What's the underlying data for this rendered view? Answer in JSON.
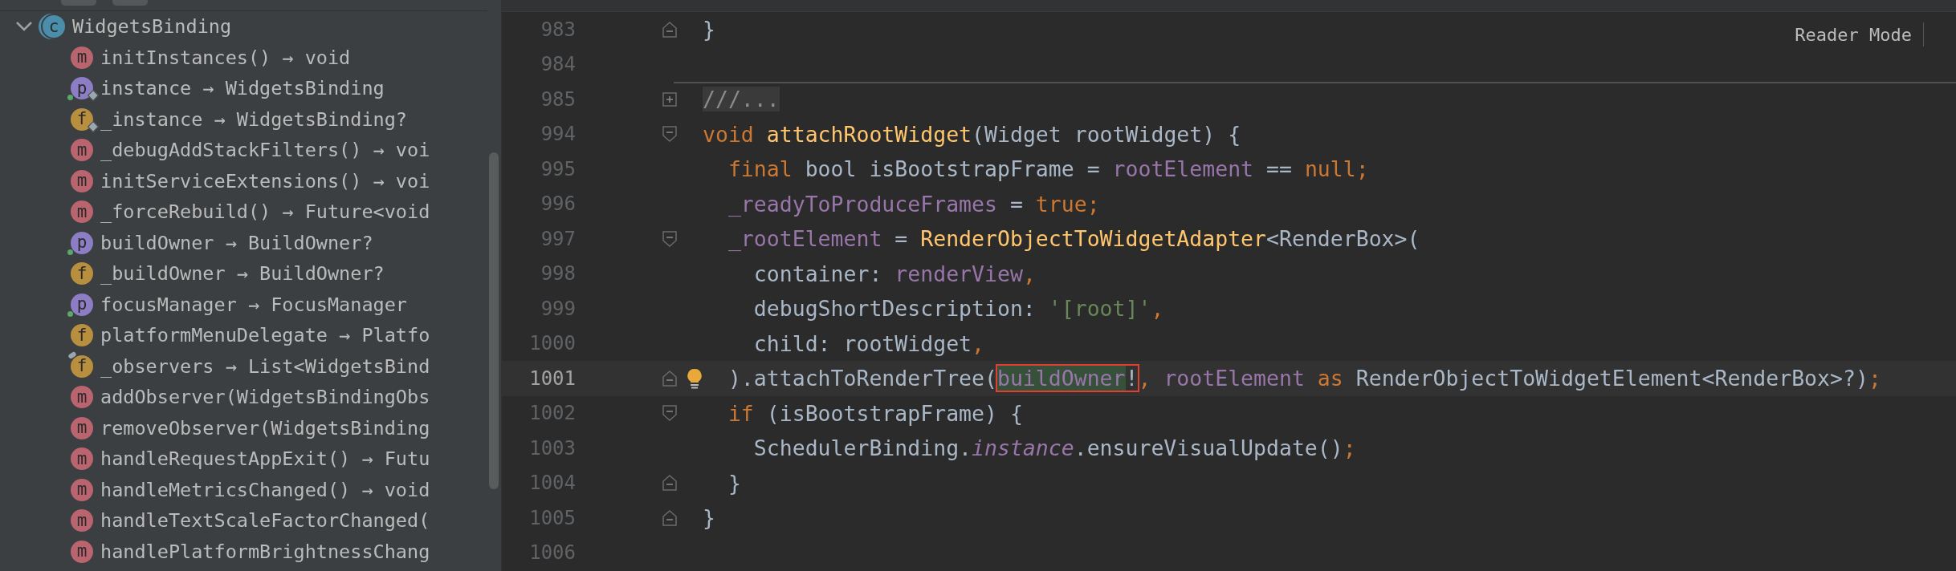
{
  "structure_panel": {
    "tree": [
      {
        "kind": "class",
        "badge": "c",
        "label": "WidgetsBinding",
        "expanded": true,
        "public_marker": false,
        "diamond_marker": false,
        "pin_marker": false,
        "children": [
          {
            "kind": "method",
            "badge": "m",
            "label": "initInstances() → void",
            "public_marker": false,
            "diamond_marker": false,
            "pin_marker": false
          },
          {
            "kind": "property",
            "badge": "p",
            "label": "instance → WidgetsBinding",
            "public_marker": true,
            "diamond_marker": true,
            "pin_marker": false
          },
          {
            "kind": "field",
            "badge": "f",
            "label": "_instance → WidgetsBinding?",
            "public_marker": false,
            "diamond_marker": true,
            "pin_marker": false
          },
          {
            "kind": "method",
            "badge": "m",
            "label": "_debugAddStackFilters() → voi",
            "public_marker": false,
            "diamond_marker": false,
            "pin_marker": false
          },
          {
            "kind": "method",
            "badge": "m",
            "label": "initServiceExtensions() → voi",
            "public_marker": false,
            "diamond_marker": false,
            "pin_marker": false
          },
          {
            "kind": "method",
            "badge": "m",
            "label": "_forceRebuild() → Future<void",
            "public_marker": false,
            "diamond_marker": false,
            "pin_marker": false
          },
          {
            "kind": "property",
            "badge": "p",
            "label": "buildOwner → BuildOwner?",
            "public_marker": true,
            "diamond_marker": false,
            "pin_marker": false
          },
          {
            "kind": "field",
            "badge": "f",
            "label": "_buildOwner → BuildOwner?",
            "public_marker": false,
            "diamond_marker": false,
            "pin_marker": false
          },
          {
            "kind": "property",
            "badge": "p",
            "label": "focusManager → FocusManager",
            "public_marker": true,
            "diamond_marker": false,
            "pin_marker": false
          },
          {
            "kind": "field",
            "badge": "f",
            "label": "platformMenuDelegate → Platfo",
            "public_marker": false,
            "diamond_marker": false,
            "pin_marker": false
          },
          {
            "kind": "field",
            "badge": "f",
            "label": "_observers → List<WidgetsBind",
            "public_marker": false,
            "diamond_marker": false,
            "pin_marker": true
          },
          {
            "kind": "method",
            "badge": "m",
            "label": "addObserver(WidgetsBindingObs",
            "public_marker": false,
            "diamond_marker": false,
            "pin_marker": false
          },
          {
            "kind": "method",
            "badge": "m",
            "label": "removeObserver(WidgetsBinding",
            "public_marker": false,
            "diamond_marker": false,
            "pin_marker": false
          },
          {
            "kind": "method",
            "badge": "m",
            "label": "handleRequestAppExit() → Futu",
            "public_marker": false,
            "diamond_marker": false,
            "pin_marker": false
          },
          {
            "kind": "method",
            "badge": "m",
            "label": "handleMetricsChanged() → void",
            "public_marker": false,
            "diamond_marker": false,
            "pin_marker": false
          },
          {
            "kind": "method",
            "badge": "m",
            "label": "handleTextScaleFactorChanged(",
            "public_marker": false,
            "diamond_marker": false,
            "pin_marker": false
          },
          {
            "kind": "method",
            "badge": "m",
            "label": "handlePlatformBrightnessChang",
            "public_marker": false,
            "diamond_marker": false,
            "pin_marker": false
          }
        ]
      }
    ]
  },
  "editor": {
    "reader_mode": {
      "label": "Reader Mode"
    },
    "lines": [
      {
        "number": "983",
        "fold": {
          "kind": "end"
        },
        "current": false,
        "tokens": [
          {
            "text": "}",
            "kind": "plain",
            "highlighted": false,
            "boxed": false
          }
        ]
      },
      {
        "number": "984",
        "current": false,
        "separator_below": true
      },
      {
        "number": "985",
        "fold": {
          "kind": "collapsed"
        },
        "current": false,
        "tokens": [
          {
            "text": "///...",
            "kind": "folded",
            "highlighted": false,
            "boxed": false
          }
        ]
      },
      {
        "number": "994",
        "fold": {
          "kind": "start"
        },
        "current": false,
        "tokens": [
          {
            "text": "void",
            "kind": "keyword",
            "highlighted": false,
            "boxed": false
          },
          {
            "text": " attachRootWidget",
            "kind": "function",
            "highlighted": false,
            "boxed": false
          },
          {
            "text": "(Widget rootWidget) {",
            "kind": "plain",
            "highlighted": false,
            "boxed": false
          }
        ]
      },
      {
        "number": "995",
        "current": false,
        "tokens": [
          {
            "text": "  final",
            "kind": "keyword",
            "highlighted": false,
            "boxed": false
          },
          {
            "text": " bool isBootstrapFrame = ",
            "kind": "plain",
            "highlighted": false,
            "boxed": false
          },
          {
            "text": "rootElement",
            "kind": "field",
            "highlighted": false,
            "boxed": false
          },
          {
            "text": " == ",
            "kind": "plain",
            "highlighted": false,
            "boxed": false
          },
          {
            "text": "null;",
            "kind": "keyword",
            "highlighted": false,
            "boxed": false
          }
        ]
      },
      {
        "number": "996",
        "current": false,
        "tokens": [
          {
            "text": "  _readyToProduceFrames",
            "kind": "field",
            "highlighted": false,
            "boxed": false
          },
          {
            "text": " = ",
            "kind": "plain",
            "highlighted": false,
            "boxed": false
          },
          {
            "text": "true;",
            "kind": "keyword",
            "highlighted": false,
            "boxed": false
          }
        ]
      },
      {
        "number": "997",
        "fold": {
          "kind": "start"
        },
        "current": false,
        "tokens": [
          {
            "text": "  _rootElement",
            "kind": "field",
            "highlighted": false,
            "boxed": false
          },
          {
            "text": " = ",
            "kind": "plain",
            "highlighted": false,
            "boxed": false
          },
          {
            "text": "RenderObjectToWidgetAdapter",
            "kind": "function",
            "highlighted": false,
            "boxed": false
          },
          {
            "text": "<RenderBox>(",
            "kind": "plain",
            "highlighted": false,
            "boxed": false
          }
        ]
      },
      {
        "number": "998",
        "current": false,
        "tokens": [
          {
            "text": "    container: ",
            "kind": "plain",
            "highlighted": false,
            "boxed": false
          },
          {
            "text": "renderView",
            "kind": "field",
            "highlighted": false,
            "boxed": false
          },
          {
            "text": ",",
            "kind": "keyword",
            "highlighted": false,
            "boxed": false
          }
        ]
      },
      {
        "number": "999",
        "current": false,
        "tokens": [
          {
            "text": "    debugShortDescription: ",
            "kind": "plain",
            "highlighted": false,
            "boxed": false
          },
          {
            "text": "'[root]'",
            "kind": "string",
            "highlighted": false,
            "boxed": false
          },
          {
            "text": ",",
            "kind": "keyword",
            "highlighted": false,
            "boxed": false
          }
        ]
      },
      {
        "number": "1000",
        "current": false,
        "tokens": [
          {
            "text": "    child: rootWidget",
            "kind": "plain",
            "highlighted": false,
            "boxed": false
          },
          {
            "text": ",",
            "kind": "keyword",
            "highlighted": false,
            "boxed": false
          }
        ]
      },
      {
        "number": "1001",
        "fold": {
          "kind": "end"
        },
        "current": true,
        "bulb": true,
        "tokens": [
          {
            "text": "  ).attachToRenderTree(",
            "kind": "plain",
            "highlighted": false,
            "boxed": false
          },
          {
            "text": "buildOwner",
            "kind": "field",
            "highlighted": true,
            "boxed": true
          },
          {
            "text": "!",
            "kind": "plain",
            "highlighted": false,
            "boxed": true
          },
          {
            "text": ",",
            "kind": "keyword",
            "highlighted": false,
            "boxed": false
          },
          {
            "text": " rootElement",
            "kind": "field",
            "highlighted": false,
            "boxed": false
          },
          {
            "text": " as ",
            "kind": "keyword",
            "highlighted": false,
            "boxed": false
          },
          {
            "text": "RenderObjectToWidgetElement<RenderBox>?)",
            "kind": "plain",
            "highlighted": false,
            "boxed": false
          },
          {
            "text": ";",
            "kind": "keyword",
            "highlighted": false,
            "boxed": false
          }
        ]
      },
      {
        "number": "1002",
        "fold": {
          "kind": "start"
        },
        "current": false,
        "tokens": [
          {
            "text": "  if",
            "kind": "keyword",
            "highlighted": false,
            "boxed": false
          },
          {
            "text": " (isBootstrapFrame) {",
            "kind": "plain",
            "highlighted": false,
            "boxed": false
          }
        ]
      },
      {
        "number": "1003",
        "current": false,
        "tokens": [
          {
            "text": "    SchedulerBinding.",
            "kind": "plain",
            "highlighted": false,
            "boxed": false
          },
          {
            "text": "instance",
            "kind": "static_field",
            "highlighted": false,
            "boxed": false
          },
          {
            "text": ".ensureVisualUpdate()",
            "kind": "plain",
            "highlighted": false,
            "boxed": false
          },
          {
            "text": ";",
            "kind": "keyword",
            "highlighted": false,
            "boxed": false
          }
        ]
      },
      {
        "number": "1004",
        "fold": {
          "kind": "end"
        },
        "current": false,
        "tokens": [
          {
            "text": "  }",
            "kind": "plain",
            "highlighted": false,
            "boxed": false
          }
        ]
      },
      {
        "number": "1005",
        "fold": {
          "kind": "end"
        },
        "current": false,
        "tokens": [
          {
            "text": "}",
            "kind": "plain",
            "highlighted": false,
            "boxed": false
          }
        ]
      },
      {
        "number": "1006",
        "current": false
      }
    ]
  }
}
